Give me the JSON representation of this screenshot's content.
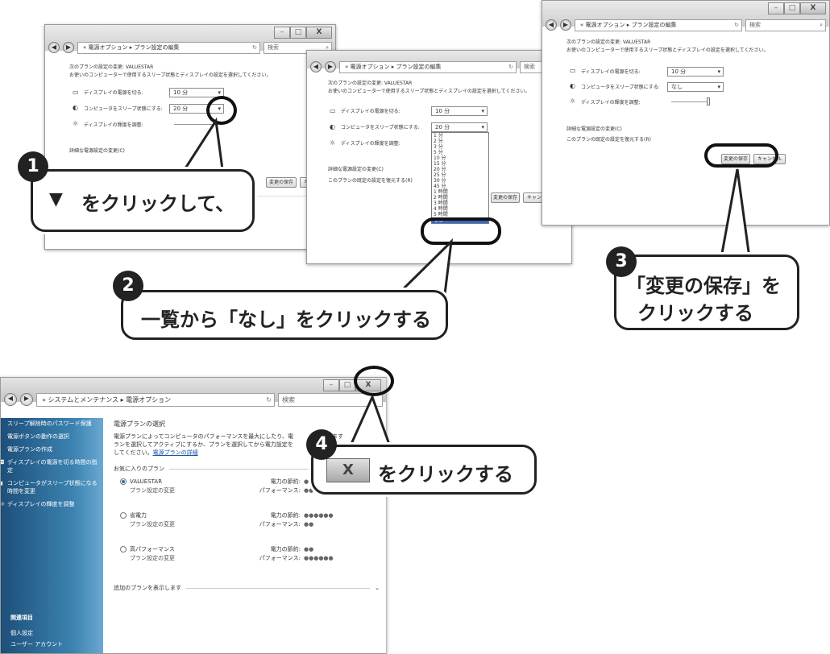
{
  "windows": {
    "address_crumb_edit": "« 電源オプション ▸ プラン設定の編集",
    "address_crumb_main": "« システムとメンテナンス ▸ 電源オプション",
    "search_placeholder": "検索",
    "refresh_glyph": "↻",
    "search_glyph": "⌕",
    "min_glyph": "–",
    "max_glyph": "□",
    "close_glyph": "X"
  },
  "plan_edit": {
    "heading": "次のプランの設定の変更: VALUESTAR",
    "subheading": "お使いのコンピューターで使用するスリープ状態とディスプレイの設定を選択してください。",
    "display_off_label": "ディスプレイの電源を切る:",
    "sleep_label": "コンピュータをスリープ状態にする:",
    "brightness_label": "ディスプレイの輝度を調整:",
    "advanced_link": "詳細な電源設定の変更(C)",
    "restore_link": "このプランの既定の設定を復元する(R)",
    "save_button": "変更の保存",
    "cancel_button": "キャンセル",
    "w1": {
      "display_value": "10 分",
      "sleep_value": "20 分"
    },
    "w2": {
      "display_value": "10 分",
      "sleep_value": "20 分"
    },
    "w3": {
      "display_value": "10 分",
      "sleep_value": "なし"
    },
    "dropdown_options": [
      "1 分",
      "2 分",
      "3 分",
      "5 分",
      "10 分",
      "15 分",
      "20 分",
      "25 分",
      "30 分",
      "45 分",
      "1 時間",
      "2 時間",
      "3 時間",
      "4 時間",
      "5 時間",
      "なし"
    ],
    "selected_option": "なし"
  },
  "power_options": {
    "sidebar": {
      "items": [
        "スリープ解除時のパスワード保護",
        "電源ボタンの動作の選択",
        "電源プランの作成",
        "ディスプレイの電源を切る時間の指定",
        "コンピュータがスリープ状態になる時間を変更",
        "ディスプレイの輝度を調整"
      ],
      "related_heading": "関連項目",
      "related_items": [
        "個人設定",
        "ユーザー アカウント"
      ]
    },
    "title": "電源プランの選択",
    "description_1": "電源プランによってコンピュータのパフォーマンスを最大にしたり、電",
    "description_1b": "たりできます",
    "description_2": "ランを選択してアクティブにするか、プランを選択してから電力設定を",
    "description_3": "してください。",
    "details_link": "電源プランの詳細",
    "favorites_heading": "お気に入りのプラン",
    "plans": [
      {
        "name": "VALUESTAR",
        "change": "プラン設定の変更",
        "saving_label": "電力の節約:",
        "saving_value": "●●",
        "perf_label": "パフォーマンス:",
        "perf_value": "●●"
      },
      {
        "name": "省電力",
        "change": "プラン設定の変更",
        "saving_label": "電力の節約:",
        "saving_value": "●●●●●●",
        "perf_label": "パフォーマンス:",
        "perf_value": "●●"
      },
      {
        "name": "高パフォーマンス",
        "change": "プラン設定の変更",
        "saving_label": "電力の節約:",
        "saving_value": "●●",
        "perf_label": "パフォーマンス:",
        "perf_value": "●●●●●●"
      }
    ],
    "more_plans": "追加のプランを表示します"
  },
  "callouts": {
    "step1_num": "1",
    "step1_text": "をクリックして、",
    "step1_icon": "▼",
    "step2_num": "2",
    "step2_text": "一覧から「なし」をクリックする",
    "step3_num": "3",
    "step3_line1": "「変更の保存」を",
    "step3_line2": "クリックする",
    "step4_num": "4",
    "step4_text": "をクリックする",
    "step4_icon": "X"
  }
}
